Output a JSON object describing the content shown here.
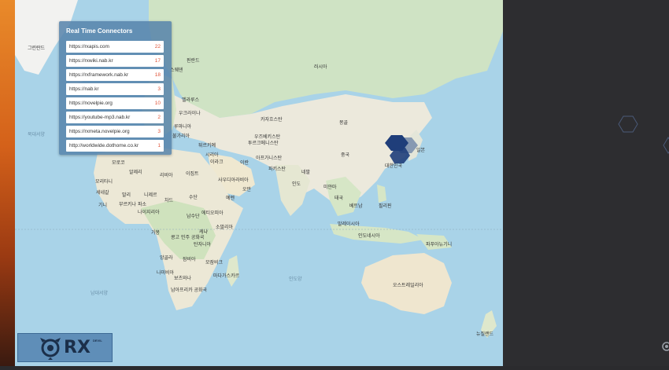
{
  "panel": {
    "title": "Real Time Connectors",
    "connectors": [
      {
        "url": "https://rxapis.com",
        "count": "22"
      },
      {
        "url": "https://rxwiki.nab.kr",
        "count": "17"
      },
      {
        "url": "https://rxframework.nab.kr",
        "count": "18"
      },
      {
        "url": "https://nab.kr",
        "count": "3"
      },
      {
        "url": "https://novelpie.org",
        "count": "10"
      },
      {
        "url": "https://youtube-mp3.nab.kr",
        "count": "2"
      },
      {
        "url": "https://rxmeta.novelpie.org",
        "count": "3"
      },
      {
        "url": "http://worldwide.dothome.co.kr",
        "count": "1"
      }
    ]
  },
  "logo": {
    "text": "RX",
    "sub": "DEVIL"
  },
  "map_labels": {
    "greenland": "그린란드",
    "russia": "러시아",
    "finland": "핀란드",
    "sweden": "스웨덴",
    "belarus": "벨라루스",
    "ukraine": "우크라이나",
    "kazakhstan": "카자흐스탄",
    "mongolia": "몽골",
    "turkey": "튀르키예",
    "syria": "시리아",
    "iraq": "이라크",
    "iran": "이란",
    "uzbekistan": "우즈베키스탄",
    "turkmenistan": "투르크메니스탄",
    "afghanistan": "아프가니스탄",
    "pakistan": "파키스탄",
    "china": "중국",
    "japan": "일본",
    "korea": "대한민국",
    "india": "인도",
    "nepal": "네팔",
    "myanmar": "미얀마",
    "thailand": "태국",
    "vietnam": "베트남",
    "philippines": "필리핀",
    "malaysia": "말레이시아",
    "indonesia": "인도네시아",
    "png": "파푸아뉴기니",
    "australia": "오스트레일리아",
    "nz": "뉴질랜드",
    "morocco": "모로코",
    "algeria": "알제리",
    "libya": "리비아",
    "egypt": "이집트",
    "saudi": "사우디아라비아",
    "yemen": "예멘",
    "oman": "오만",
    "mauritania": "모리타니",
    "mali": "말리",
    "niger": "니제르",
    "chad": "차드",
    "sudan": "수단",
    "ethiopia": "에티오피아",
    "south_sudan": "남수단",
    "somalia": "소말리아",
    "kenya": "케냐",
    "tanzania": "탄자니아",
    "drc": "콩고 민주 공화국",
    "gabon": "가봉",
    "angola": "앙골라",
    "zambia": "잠비아",
    "mozambique": "모잠비크",
    "namibia": "나미비아",
    "botswana": "보츠와나",
    "south_africa": "남아프리카 공화국",
    "madagascar": "마다가스카르",
    "senegal": "세네갈",
    "guinea": "기니",
    "burkina": "부르키나 파소",
    "nigeria": "나이지리아",
    "bulgaria": "불가리아",
    "romania": "루마니아",
    "atlantic": "북대서양",
    "south_atlantic": "남대서양",
    "indian_ocean": "인도양"
  }
}
